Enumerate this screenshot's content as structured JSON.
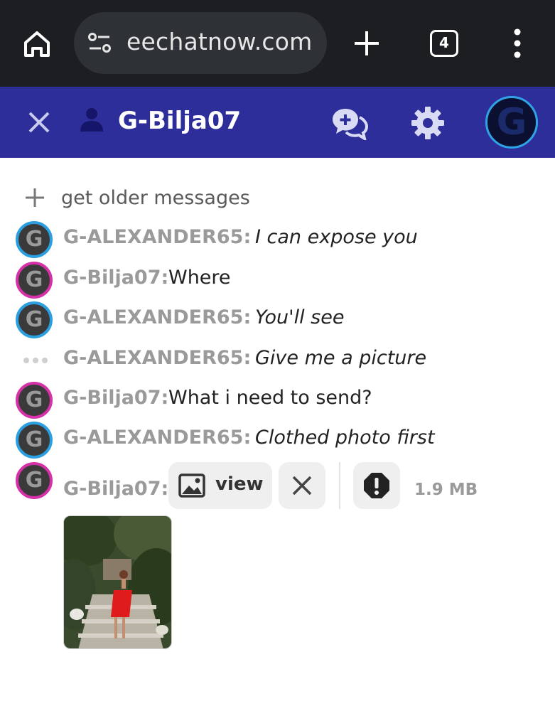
{
  "browser": {
    "url": "eechatnow.com",
    "tab_count": "4"
  },
  "header": {
    "title": "G-Bilja07",
    "avatar_letter": "G"
  },
  "chat": {
    "older_label": "get older messages",
    "messages": [
      {
        "author": "G-ALEXANDER65:",
        "text": "I can expose you",
        "italic": true,
        "avatar": "blue"
      },
      {
        "author": "G-Bilja07:",
        "text": "Where",
        "italic": false,
        "avatar": "pink"
      },
      {
        "author": "G-ALEXANDER65:",
        "text": "You'll see",
        "italic": true,
        "avatar": "blue"
      },
      {
        "author": "G-ALEXANDER65:",
        "text": "Give me a picture",
        "italic": true,
        "avatar": "dots"
      },
      {
        "author": "G-Bilja07:",
        "text": "What i need to send?",
        "italic": false,
        "avatar": "pink"
      },
      {
        "author": "G-ALEXANDER65:",
        "text": "Clothed photo first",
        "italic": true,
        "avatar": "blue"
      }
    ],
    "attachment": {
      "author": "G-Bilja07:",
      "view_label": "view",
      "file_size": "1.9 MB"
    },
    "avatar_letter": "G"
  },
  "colors": {
    "browser_bar": "#1c1e22",
    "header": "#2e2e9a",
    "avatar_blue_ring": "#2b9fe0",
    "avatar_pink_ring": "#d631a8"
  }
}
